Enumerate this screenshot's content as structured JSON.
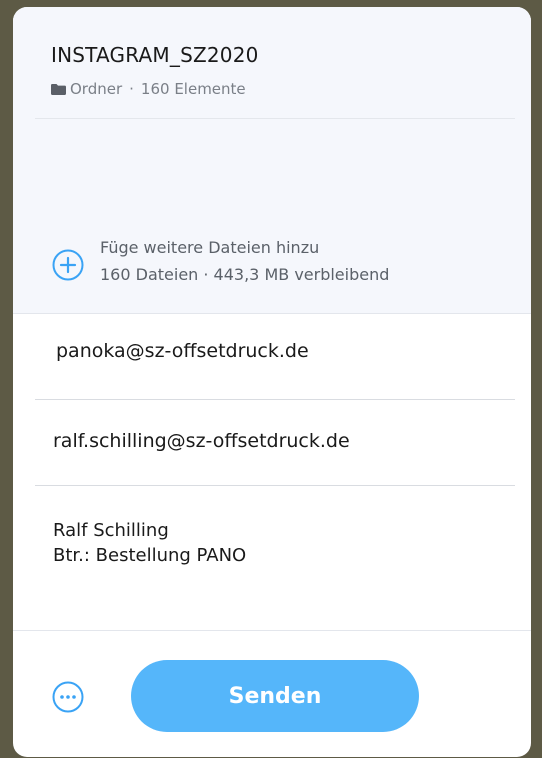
{
  "transfer": {
    "title": "INSTAGRAM_SZ2020",
    "type_label": "Ordner",
    "separator": "·",
    "count_label": "160 Elemente"
  },
  "add_files": {
    "label": "Füge weitere Dateien hinzu",
    "sublabel": "160 Dateien · 443,3 MB verbleibend",
    "icon": "plus-circle-icon"
  },
  "fields": {
    "recipient": "panoka@sz-offsetdruck.de",
    "sender": "ralf.schilling@sz-offsetdruck.de",
    "message_line1": "Ralf Schilling",
    "message_line2": "Btr.: Bestellung PANO"
  },
  "footer": {
    "more_icon": "more-options-icon",
    "send_label": "Senden"
  },
  "colors": {
    "accent": "#55b6fa",
    "header_bg": "#f5f7fc",
    "background": "#5d5a45"
  }
}
